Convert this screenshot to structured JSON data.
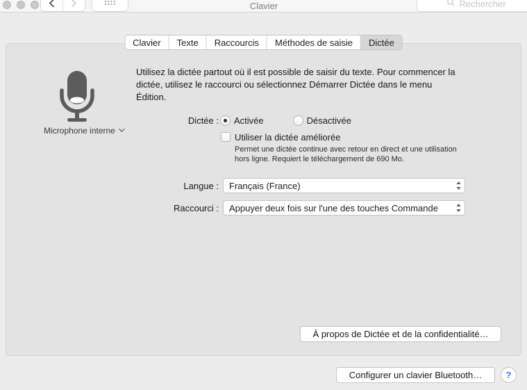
{
  "window": {
    "title": "Clavier",
    "search_placeholder": "Rechercher"
  },
  "toolbar": {
    "back_icon": "chevron-left",
    "forward_icon": "chevron-right",
    "show_all_icon": "grid-dots"
  },
  "tabs": [
    {
      "label": "Clavier",
      "selected": false
    },
    {
      "label": "Texte",
      "selected": false
    },
    {
      "label": "Raccourcis",
      "selected": false
    },
    {
      "label": "Méthodes de saisie",
      "selected": false
    },
    {
      "label": "Dictée",
      "selected": true
    }
  ],
  "microphone": {
    "icon": "microphone-icon",
    "label": "Microphone interne"
  },
  "description": {
    "lines": [
      "Utilisez la dictée partout où il est possible de saisir du texte. Pour commencer la",
      "dictée, utilisez le raccourci ou sélectionnez Démarrer Dictée dans le menu",
      "Édition."
    ]
  },
  "dictation": {
    "label": "Dictée :",
    "options": [
      {
        "label": "Activée",
        "selected": true
      },
      {
        "label": "Désactivée",
        "selected": false
      }
    ]
  },
  "enhanced_dictation": {
    "label": "Utiliser la dictée améliorée",
    "checked": false,
    "help_lines": [
      "Permet une dictée continue avec retour en direct et une utilisation",
      "hors ligne. Requiert le téléchargement de 690 Mo."
    ]
  },
  "language": {
    "label": "Langue :",
    "value": "Français (France)"
  },
  "shortcut": {
    "label": "Raccourci :",
    "value": "Appuyer deux fois sur l'une des touches Commande"
  },
  "buttons": {
    "about": "À propos de Dictée et de la confidentialité…",
    "bluetooth": "Configurer un clavier Bluetooth…",
    "help": "?"
  },
  "colors": {
    "help_blue": "#2d7cf7",
    "panel_bg": "#e3e3e3",
    "window_bg": "#ececec",
    "selected_tab_bg": "#d6d6d6"
  }
}
